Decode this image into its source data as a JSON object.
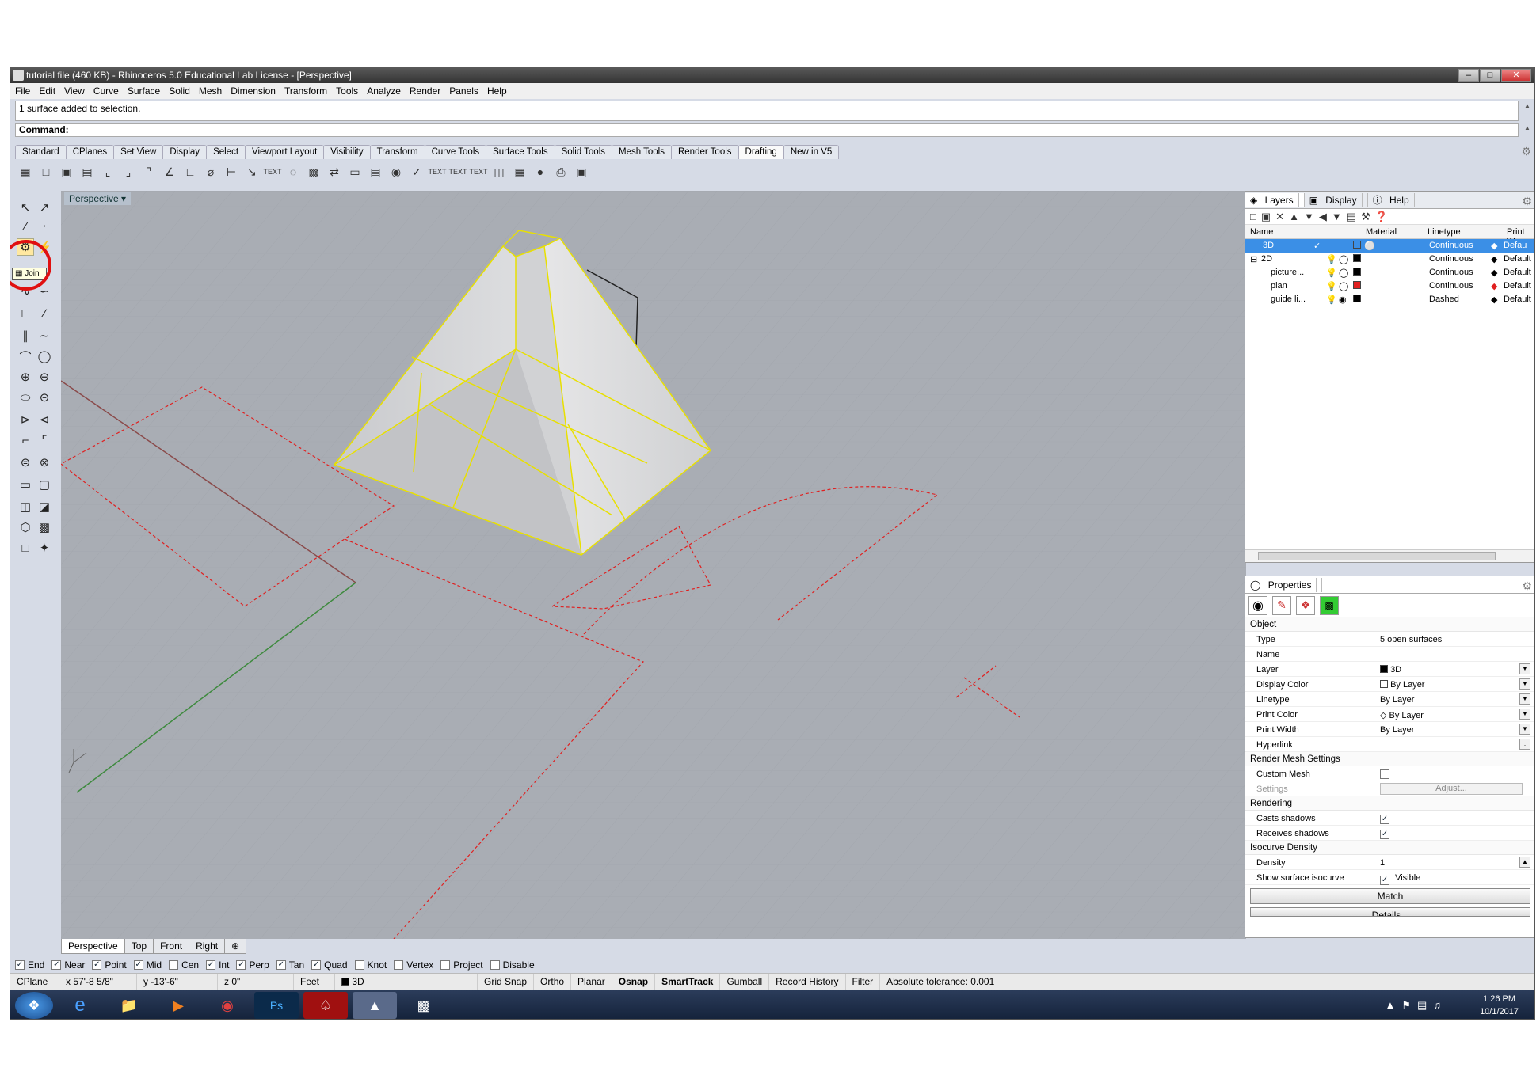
{
  "window": {
    "title": "tutorial file (460 KB) - Rhinoceros 5.0 Educational Lab License - [Perspective]"
  },
  "menu": [
    "File",
    "Edit",
    "View",
    "Curve",
    "Surface",
    "Solid",
    "Mesh",
    "Dimension",
    "Transform",
    "Tools",
    "Analyze",
    "Render",
    "Panels",
    "Help"
  ],
  "history": {
    "text": "1 surface added to selection."
  },
  "command": {
    "label": "Command:"
  },
  "toolbar_tabs": [
    "Standard",
    "CPlanes",
    "Set View",
    "Display",
    "Select",
    "Viewport Layout",
    "Visibility",
    "Transform",
    "Curve Tools",
    "Surface Tools",
    "Solid Tools",
    "Mesh Tools",
    "Render Tools",
    "Drafting",
    "New in V5"
  ],
  "active_toolbar_tab": "Drafting",
  "tooltip": {
    "join": "Join"
  },
  "viewport": {
    "label": "Perspective"
  },
  "viewport_tabs": [
    "Perspective",
    "Top",
    "Front",
    "Right"
  ],
  "osnaps": [
    {
      "label": "End",
      "checked": true
    },
    {
      "label": "Near",
      "checked": true
    },
    {
      "label": "Point",
      "checked": true
    },
    {
      "label": "Mid",
      "checked": true
    },
    {
      "label": "Cen",
      "checked": false
    },
    {
      "label": "Int",
      "checked": true
    },
    {
      "label": "Perp",
      "checked": true
    },
    {
      "label": "Tan",
      "checked": true
    },
    {
      "label": "Quad",
      "checked": true
    },
    {
      "label": "Knot",
      "checked": false
    },
    {
      "label": "Vertex",
      "checked": false
    },
    {
      "label": "Project",
      "checked": false
    },
    {
      "label": "Disable",
      "checked": false
    }
  ],
  "status": {
    "cplane": "CPlane",
    "x": "x 57'-8 5/8\"",
    "y": "y -13'-6\"",
    "z": "z 0\"",
    "units": "Feet",
    "layer": "3D",
    "grid_snap": "Grid Snap",
    "ortho": "Ortho",
    "planar": "Planar",
    "osnap": "Osnap",
    "smarttrack": "SmartTrack",
    "gumball": "Gumball",
    "record_history": "Record History",
    "filter": "Filter",
    "tolerance": "Absolute tolerance: 0.001"
  },
  "layers_panel": {
    "tabs": [
      "Layers",
      "Display",
      "Help"
    ],
    "headers": {
      "name": "Name",
      "material": "Material",
      "linetype": "Linetype",
      "print": "Print W"
    },
    "rows": [
      {
        "name": "3D",
        "linetype": "Continuous",
        "print": "Defau",
        "color": "#000000",
        "selected": true
      },
      {
        "name": "2D",
        "linetype": "Continuous",
        "print": "Default",
        "color": "#000000",
        "selected": false
      },
      {
        "name": "picture...",
        "linetype": "Continuous",
        "print": "Default",
        "color": "#000000",
        "selected": false
      },
      {
        "name": "plan",
        "linetype": "Continuous",
        "print": "Default",
        "color": "#e02020",
        "selected": false
      },
      {
        "name": "guide li...",
        "linetype": "Dashed",
        "print": "Default",
        "color": "#000000",
        "selected": false
      }
    ]
  },
  "properties_panel": {
    "title": "Properties",
    "object_group": "Object",
    "fields": [
      {
        "key": "Type",
        "value": "5 open surfaces"
      },
      {
        "key": "Name",
        "value": ""
      },
      {
        "key": "Layer",
        "value": "3D"
      },
      {
        "key": "Display Color",
        "value": "By Layer"
      },
      {
        "key": "Linetype",
        "value": "By Layer"
      },
      {
        "key": "Print Color",
        "value": "By Layer"
      },
      {
        "key": "Print Width",
        "value": "By Layer"
      },
      {
        "key": "Hyperlink",
        "value": ""
      }
    ],
    "render_mesh_group": "Render Mesh Settings",
    "custom_mesh": "Custom Mesh",
    "settings": "Settings",
    "adjust": "Adjust...",
    "rendering_group": "Rendering",
    "casts_shadows": "Casts shadows",
    "receives_shadows": "Receives shadows",
    "isocurve_group": "Isocurve Density",
    "density_label": "Density",
    "density_value": "1",
    "show_isocurve": "Show surface isocurve",
    "visible": "Visible",
    "match": "Match",
    "details": "Details..."
  },
  "taskbar": {
    "time": "1:26 PM",
    "date": "10/1/2017"
  },
  "colors": {
    "selection": "#e8e000",
    "plan_lines": "#e02020",
    "viewport_bg": "#a9adb4",
    "accent": "#3b8fe6"
  }
}
